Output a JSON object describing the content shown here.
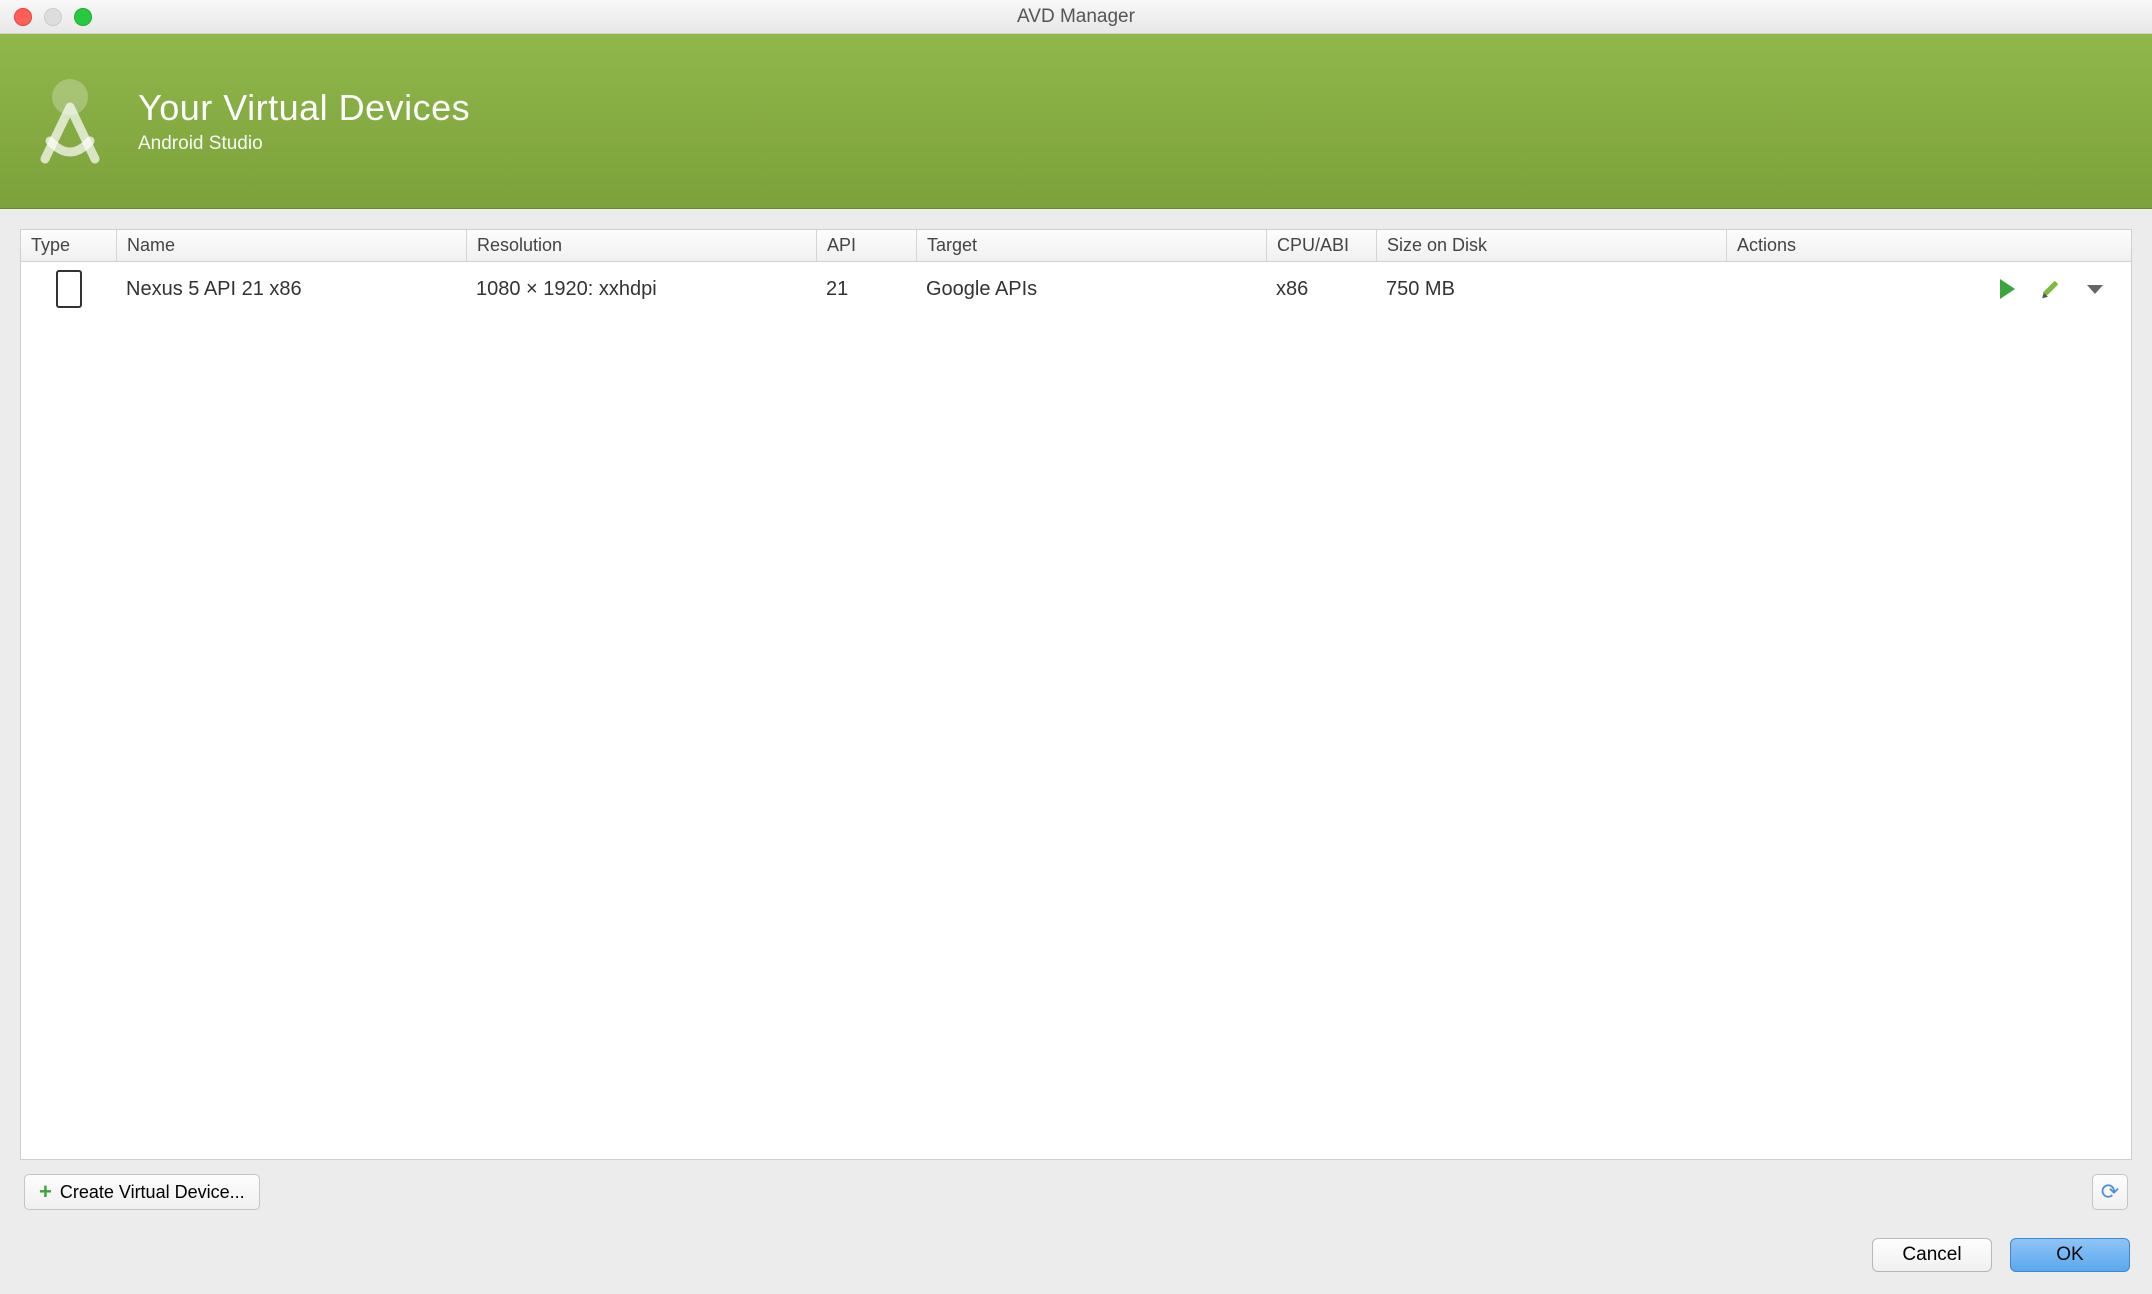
{
  "window_title": "AVD Manager",
  "banner": {
    "title": "Your Virtual Devices",
    "subtitle": "Android Studio"
  },
  "table": {
    "columns": {
      "type": "Type",
      "name": "Name",
      "resolution": "Resolution",
      "api": "API",
      "target": "Target",
      "cpu": "CPU/ABI",
      "size": "Size on Disk",
      "actions": "Actions"
    },
    "rows": [
      {
        "type_icon": "phone",
        "name": "Nexus 5 API 21 x86",
        "resolution": "1080 × 1920: xxhdpi",
        "api": "21",
        "target": "Google APIs",
        "cpu": "x86",
        "size": "750 MB"
      }
    ]
  },
  "buttons": {
    "create": "Create Virtual Device...",
    "cancel": "Cancel",
    "ok": "OK"
  },
  "colors": {
    "accent_green": "#83a93f",
    "primary_blue": "#5aa8ed"
  }
}
